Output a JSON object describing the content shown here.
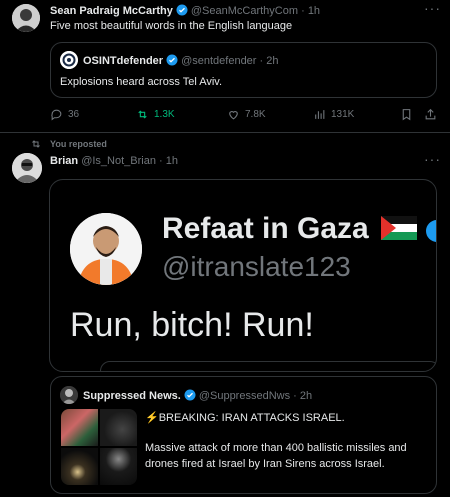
{
  "tweet1": {
    "name": "Sean Padraig McCarthy",
    "handle": "@SeanMcCarthyCom",
    "time": "· 1h",
    "text": "Five most beautiful words in the English language",
    "quote": {
      "name": "OSINTdefender",
      "handle": "@sentdefender",
      "time": "· 2h",
      "text": "Explosions heard across Tel Aviv."
    },
    "stats": {
      "replies": "36",
      "reposts": "1.3K",
      "likes": "7.8K",
      "views": "131K"
    }
  },
  "tweet2": {
    "repost_label": "You reposted",
    "name": "Brian",
    "handle": "@Is_Not_Brian",
    "time": "· 1h",
    "image": {
      "name": "Refaat in Gaza",
      "handle": "@itranslate123",
      "text": "Run, bitch! Run!"
    },
    "quote": {
      "name": "Suppressed News.",
      "handle": "@SuppressedNws",
      "time": "· 2h",
      "headline": "⚡BREAKING: IRAN ATTACKS ISRAEL.",
      "text": "Massive attack of more than 400 ballistic missiles and drones fired at Israel by Iran Sirens across Israel."
    }
  },
  "colors": {
    "verified": "#1d9bf0",
    "repost_green": "#00ba7c",
    "border": "#2f3336",
    "muted": "#71767b"
  }
}
